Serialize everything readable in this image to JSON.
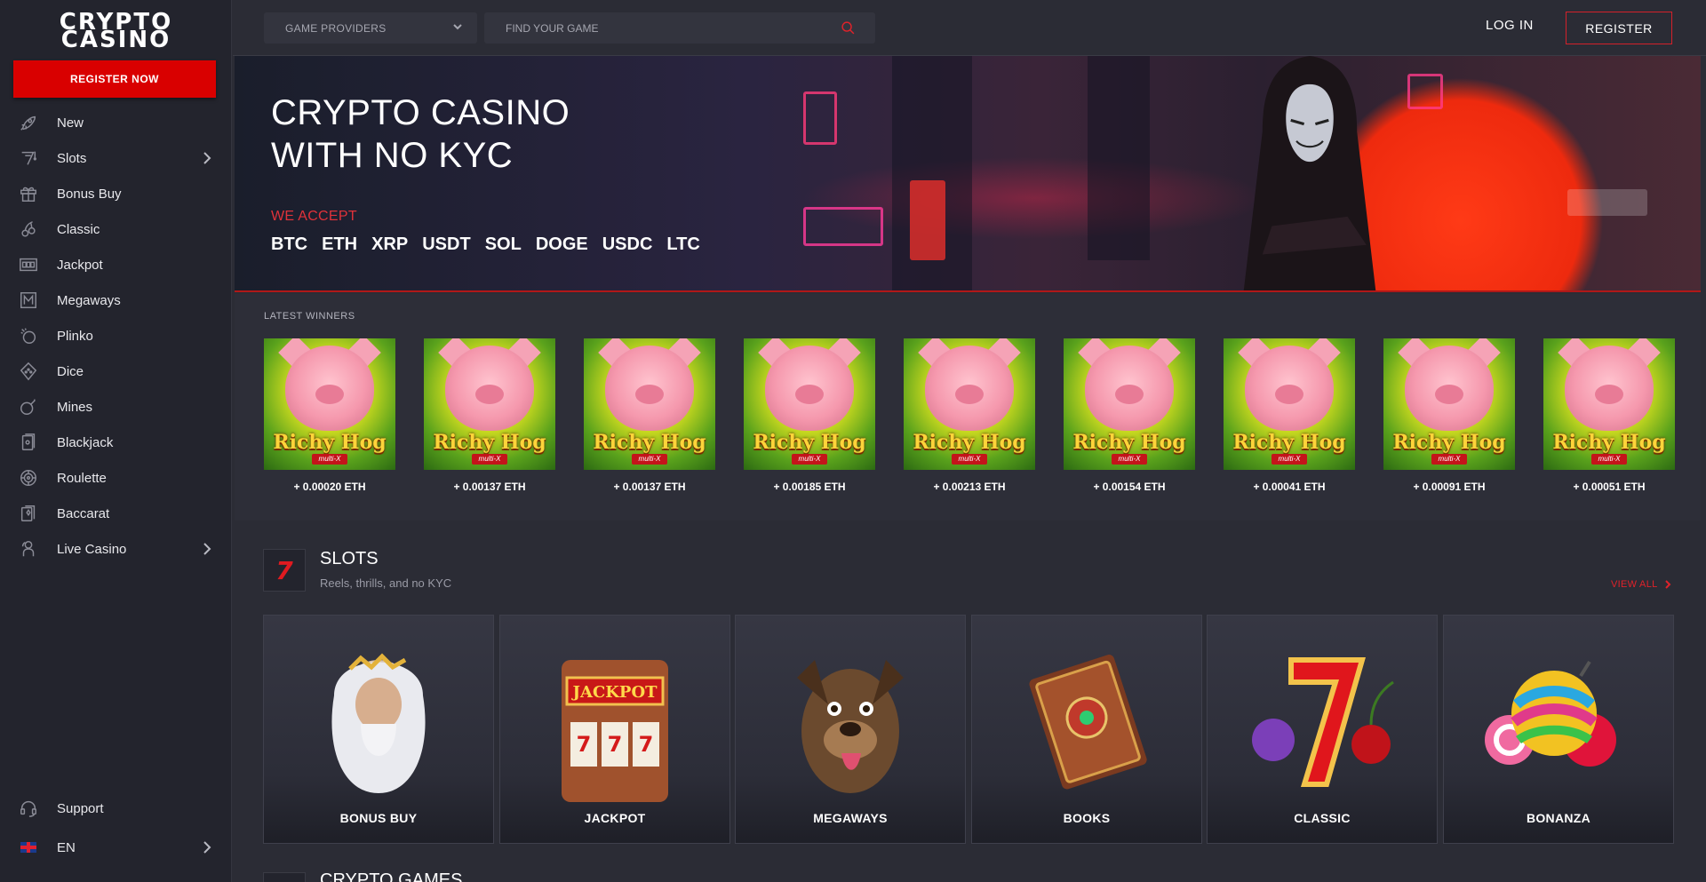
{
  "brand": {
    "line1": "CRYPTO",
    "line2": "CASINO"
  },
  "sidebar": {
    "register_now": "REGISTER NOW",
    "items": [
      {
        "label": "New",
        "icon": "rocket-icon"
      },
      {
        "label": "Slots",
        "icon": "slot-seven-icon",
        "has_submenu": true
      },
      {
        "label": "Bonus Buy",
        "icon": "gift-icon"
      },
      {
        "label": "Classic",
        "icon": "cherries-icon"
      },
      {
        "label": "Jackpot",
        "icon": "jackpot-icon"
      },
      {
        "label": "Megaways",
        "icon": "megaways-icon"
      },
      {
        "label": "Plinko",
        "icon": "plinko-icon"
      },
      {
        "label": "Dice",
        "icon": "dice-icon"
      },
      {
        "label": "Mines",
        "icon": "bomb-icon"
      },
      {
        "label": "Blackjack",
        "icon": "cards-icon"
      },
      {
        "label": "Roulette",
        "icon": "roulette-icon"
      },
      {
        "label": "Baccarat",
        "icon": "baccarat-icon"
      },
      {
        "label": "Live Casino",
        "icon": "live-dealer-icon",
        "has_submenu": true
      }
    ],
    "support": "Support",
    "language": "EN"
  },
  "header": {
    "providers": "GAME PROVIDERS",
    "search_placeholder": "FIND YOUR GAME",
    "login": "LOG IN",
    "register": "REGISTER"
  },
  "hero": {
    "title_line1": "CRYPTO CASINO",
    "title_line2": "WITH NO KYC",
    "accept_label": "WE ACCEPT",
    "coins": [
      "BTC",
      "ETH",
      "XRP",
      "USDT",
      "SOL",
      "DOGE",
      "USDC",
      "LTC"
    ]
  },
  "winners": {
    "label": "LATEST WINNERS",
    "game_title": "Richy Hog",
    "game_subtitle": "multi-X",
    "items": [
      {
        "amount": "+ 0.00020 ETH"
      },
      {
        "amount": "+ 0.00137 ETH"
      },
      {
        "amount": "+ 0.00137 ETH"
      },
      {
        "amount": "+ 0.00185 ETH"
      },
      {
        "amount": "+ 0.00213 ETH"
      },
      {
        "amount": "+ 0.00154 ETH"
      },
      {
        "amount": "+ 0.00041 ETH"
      },
      {
        "amount": "+ 0.00091 ETH"
      },
      {
        "amount": "+ 0.00051 ETH"
      }
    ]
  },
  "slots": {
    "icon_glyph": "7",
    "title": "SLOTS",
    "subtitle": "Reels, thrills, and no KYC",
    "view_all": "VIEW ALL",
    "categories": [
      {
        "label": "BONUS BUY",
        "art": "zeus"
      },
      {
        "label": "JACKPOT",
        "art": "slot-machine",
        "sign": "JACKPOT"
      },
      {
        "label": "MEGAWAYS",
        "art": "dog"
      },
      {
        "label": "BOOKS",
        "art": "book"
      },
      {
        "label": "CLASSIC",
        "art": "seven-fruits"
      },
      {
        "label": "BONANZA",
        "art": "candy"
      }
    ]
  },
  "next_section": {
    "title": "CRYPTO GAMES"
  },
  "colors": {
    "accent": "#d90000",
    "sidebar_bg": "#23242d",
    "page_bg": "#2b2c35"
  }
}
